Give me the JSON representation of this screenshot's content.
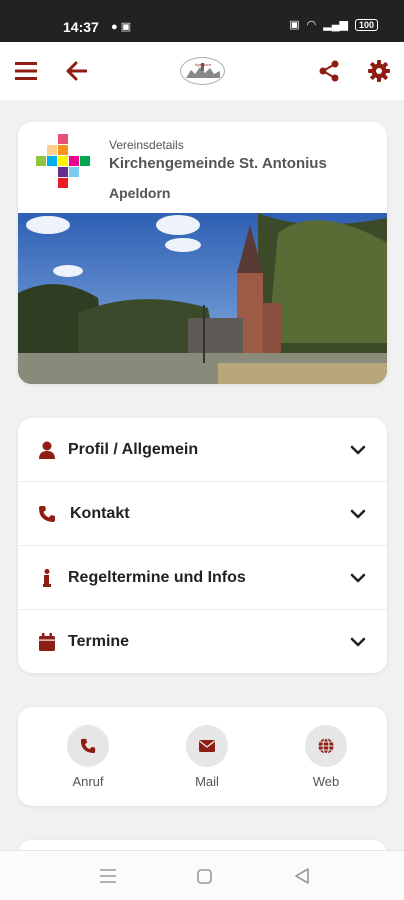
{
  "status_bar": {
    "time": "14:37",
    "battery": "100"
  },
  "app_bar": {
    "logo_text": "Apeldorn"
  },
  "club": {
    "section_label": "Vereinsdetails",
    "name": "Kirchengemeinde St. Antonius",
    "city": "Apeldorn"
  },
  "accordion": [
    {
      "label": "Profil / Allgemein",
      "icon": "person-icon"
    },
    {
      "label": "Kontakt",
      "icon": "phone-icon"
    },
    {
      "label": "Regeltermine und Infos",
      "icon": "info-icon"
    },
    {
      "label": "Termine",
      "icon": "calendar-icon"
    }
  ],
  "actions": [
    {
      "label": "Anruf",
      "icon": "phone-icon"
    },
    {
      "label": "Mail",
      "icon": "mail-icon"
    },
    {
      "label": "Web",
      "icon": "globe-icon"
    }
  ],
  "colors": {
    "accent": "#8e1d14",
    "background": "#f1f1f1"
  }
}
